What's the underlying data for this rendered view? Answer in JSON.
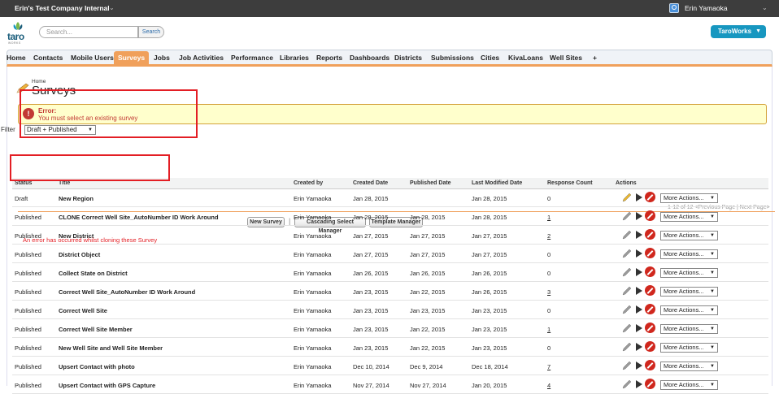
{
  "topbar": {
    "org": "Erin's Test Company Internal",
    "user": "Erin Yamaoka"
  },
  "header": {
    "logo_text": "taro",
    "logo_sub": "WORKS",
    "search_placeholder": "Search...",
    "search_button": "Search",
    "app_switcher": "TaroWorks"
  },
  "tabs": [
    "Home",
    "Contacts",
    "Mobile Users",
    "Surveys",
    "Jobs",
    "Job Activities",
    "Performance",
    "Libraries",
    "Reports",
    "Dashboards",
    "Districts",
    "Submissions",
    "Cities",
    "KivaLoans",
    "Well Sites",
    "+"
  ],
  "active_tab": "Surveys",
  "page": {
    "breadcrumb": "Home",
    "title": "Surveys",
    "error_title": "Error:",
    "error_message": "You must select an existing survey",
    "filter_label": "Filter",
    "filter_value": "Draft + Published",
    "pagination": "1-12 of 12 <Previous Page | Next Page>",
    "buttons": {
      "new_survey": "New Survey",
      "cascading": "Cascading Select Manager",
      "template": "Template Manager"
    },
    "clone_error": "An error has occurred whilst cloning these Survey"
  },
  "table": {
    "headers": [
      "Status",
      "Title",
      "Created by",
      "Created Date",
      "Published Date",
      "Last Modified Date",
      "Response Count",
      "Actions"
    ],
    "more_actions_label": "More Actions...",
    "rows": [
      {
        "status": "Draft",
        "title": "New Region",
        "created_by": "Erin Yamaoka",
        "created": "Jan 28, 2015",
        "published": "",
        "modified": "Jan 28, 2015",
        "responses": "0",
        "link": false,
        "draft": true
      },
      {
        "status": "Published",
        "title": "CLONE Correct Well Site_AutoNumber ID Work Around",
        "created_by": "Erin Yamaoka",
        "created": "Jan 28, 2015",
        "published": "Jan 28, 2015",
        "modified": "Jan 28, 2015",
        "responses": "1",
        "link": true
      },
      {
        "status": "Published",
        "title": "New District",
        "created_by": "Erin Yamaoka",
        "created": "Jan 27, 2015",
        "published": "Jan 27, 2015",
        "modified": "Jan 27, 2015",
        "responses": "2",
        "link": true
      },
      {
        "status": "Published",
        "title": "District Object",
        "created_by": "Erin Yamaoka",
        "created": "Jan 27, 2015",
        "published": "Jan 27, 2015",
        "modified": "Jan 27, 2015",
        "responses": "0",
        "link": false
      },
      {
        "status": "Published",
        "title": "Collect State on District",
        "created_by": "Erin Yamaoka",
        "created": "Jan 26, 2015",
        "published": "Jan 26, 2015",
        "modified": "Jan 26, 2015",
        "responses": "0",
        "link": false
      },
      {
        "status": "Published",
        "title": "Correct Well Site_AutoNumber ID Work Around",
        "created_by": "Erin Yamaoka",
        "created": "Jan 23, 2015",
        "published": "Jan 22, 2015",
        "modified": "Jan 26, 2015",
        "responses": "3",
        "link": true
      },
      {
        "status": "Published",
        "title": "Correct Well Site",
        "created_by": "Erin Yamaoka",
        "created": "Jan 23, 2015",
        "published": "Jan 23, 2015",
        "modified": "Jan 23, 2015",
        "responses": "0",
        "link": false
      },
      {
        "status": "Published",
        "title": "Correct Well Site Member",
        "created_by": "Erin Yamaoka",
        "created": "Jan 23, 2015",
        "published": "Jan 22, 2015",
        "modified": "Jan 23, 2015",
        "responses": "1",
        "link": true
      },
      {
        "status": "Published",
        "title": "New Well Site and Well Site Member",
        "created_by": "Erin Yamaoka",
        "created": "Jan 23, 2015",
        "published": "Jan 22, 2015",
        "modified": "Jan 23, 2015",
        "responses": "0",
        "link": false
      },
      {
        "status": "Published",
        "title": "Upsert Contact with photo",
        "created_by": "Erin Yamaoka",
        "created": "Dec 10, 2014",
        "published": "Dec 9, 2014",
        "modified": "Dec 18, 2014",
        "responses": "7",
        "link": true
      },
      {
        "status": "Published",
        "title": "Upsert Contact with GPS Capture",
        "created_by": "Erin Yamaoka",
        "created": "Nov 27, 2014",
        "published": "Nov 27, 2014",
        "modified": "Jan 20, 2015",
        "responses": "4",
        "link": true
      }
    ]
  },
  "colors": {
    "accent": "#f0a05b",
    "error": "#c23934",
    "annotation": "#e31e24",
    "app": "#1797c0"
  }
}
